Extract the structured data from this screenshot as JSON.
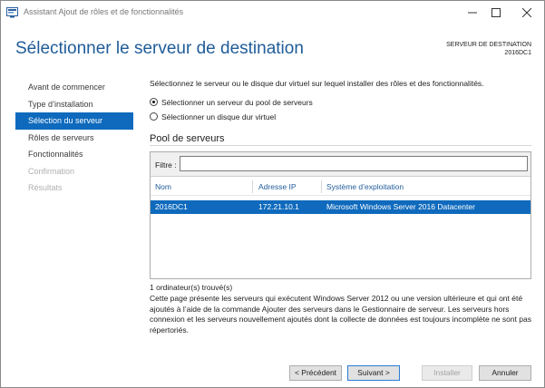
{
  "window": {
    "title": "Assistant Ajout de rôles et de fonctionnalités"
  },
  "header": {
    "title": "Sélectionner le serveur de destination",
    "destination_label": "SERVEUR DE DESTINATION",
    "destination_name": "2016DC1"
  },
  "sidebar": {
    "items": [
      {
        "label": "Avant de commencer",
        "state": "normal"
      },
      {
        "label": "Type d’installation",
        "state": "normal"
      },
      {
        "label": "Sélection du serveur",
        "state": "active"
      },
      {
        "label": "Rôles de serveurs",
        "state": "normal"
      },
      {
        "label": "Fonctionnalités",
        "state": "normal"
      },
      {
        "label": "Confirmation",
        "state": "disabled"
      },
      {
        "label": "Résultats",
        "state": "disabled"
      }
    ]
  },
  "main": {
    "intro": "Sélectionnez le serveur ou le disque dur virtuel sur lequel installer des rôles et des fonctionnalités.",
    "options": [
      {
        "label": "Sélectionner un serveur du pool de serveurs",
        "checked": true
      },
      {
        "label": "Sélectionner un disque dur virtuel",
        "checked": false
      }
    ],
    "pool": {
      "title": "Pool de serveurs",
      "filter_label": "Filtre :",
      "filter_value": "",
      "columns": [
        "Nom",
        "Adresse IP",
        "Système d’exploitation"
      ],
      "rows": [
        [
          "2016DC1",
          "172.21.10.1",
          "Microsoft Windows Server 2016 Datacenter"
        ]
      ]
    },
    "count": "1 ordinateur(s) trouvé(s)",
    "description": "Cette page présente les serveurs qui exécutent Windows Server 2012 ou une version ultérieure et qui ont été ajoutés à l’aide de la commande Ajouter des serveurs dans le Gestionnaire de serveur. Les serveurs hors connexion et les serveurs nouvellement ajoutés dont la collecte de données est toujours incomplète ne sont pas répertoriés."
  },
  "footer": {
    "previous": "< Précédent",
    "next": "Suivant >",
    "install": "Installer",
    "cancel": "Annuler"
  },
  "colors": {
    "accent": "#0f6abd",
    "title": "#1f5c99"
  }
}
